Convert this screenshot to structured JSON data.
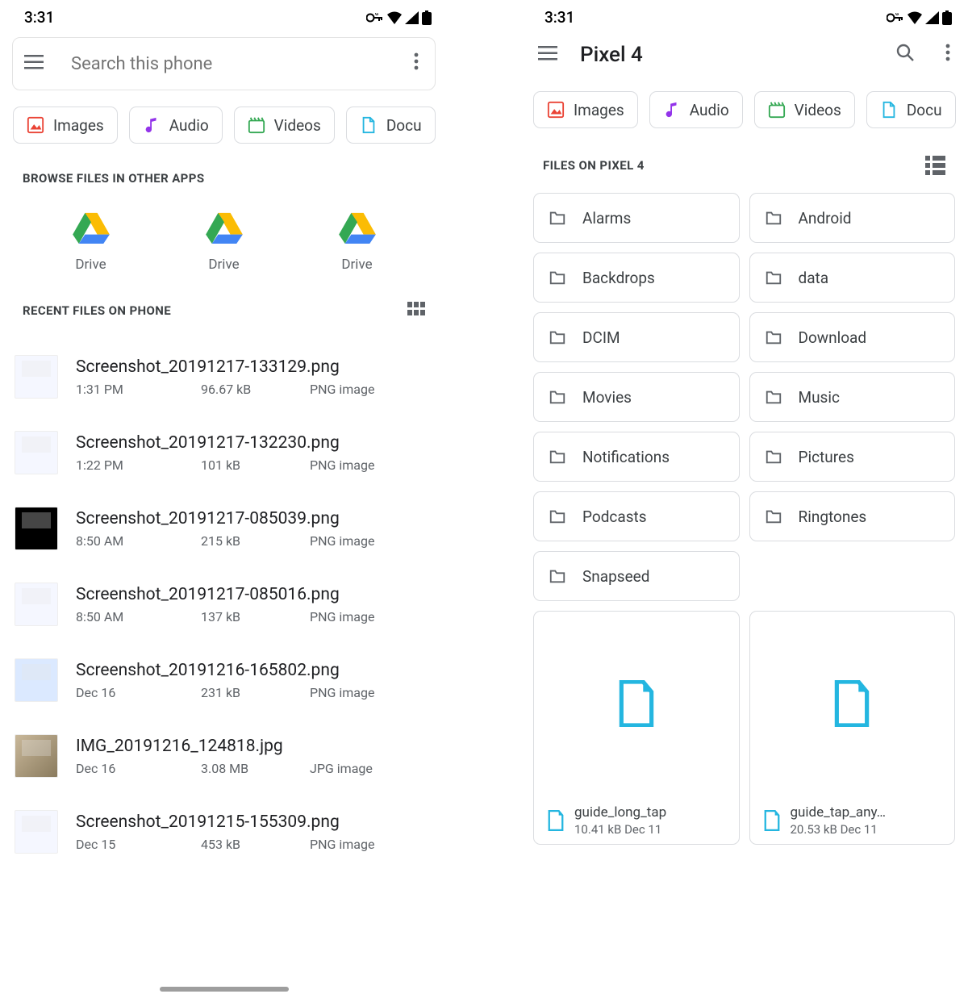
{
  "status": {
    "time": "3:31"
  },
  "left": {
    "search_placeholder": "Search this phone",
    "chips": [
      {
        "label": "Images"
      },
      {
        "label": "Audio"
      },
      {
        "label": "Videos"
      },
      {
        "label": "Docu"
      }
    ],
    "browse_header": "BROWSE FILES IN OTHER APPS",
    "drive_items": [
      {
        "label": "Drive"
      },
      {
        "label": "Drive"
      },
      {
        "label": "Drive"
      }
    ],
    "recent_header": "RECENT FILES ON PHONE",
    "files": [
      {
        "name": "Screenshot_20191217-133129.png",
        "time": "1:31 PM",
        "size": "96.67 kB",
        "type": "PNG image",
        "thumb": ""
      },
      {
        "name": "Screenshot_20191217-132230.png",
        "time": "1:22 PM",
        "size": "101 kB",
        "type": "PNG image",
        "thumb": ""
      },
      {
        "name": "Screenshot_20191217-085039.png",
        "time": "8:50 AM",
        "size": "215 kB",
        "type": "PNG image",
        "thumb": "phone"
      },
      {
        "name": "Screenshot_20191217-085016.png",
        "time": "8:50 AM",
        "size": "137 kB",
        "type": "PNG image",
        "thumb": ""
      },
      {
        "name": "Screenshot_20191216-165802.png",
        "time": "Dec 16",
        "size": "231 kB",
        "type": "PNG image",
        "thumb": "blue"
      },
      {
        "name": "IMG_20191216_124818.jpg",
        "time": "Dec 16",
        "size": "3.08 MB",
        "type": "JPG image",
        "thumb": "photo"
      },
      {
        "name": "Screenshot_20191215-155309.png",
        "time": "Dec 15",
        "size": "453 kB",
        "type": "PNG image",
        "thumb": ""
      }
    ]
  },
  "right": {
    "title": "Pixel 4",
    "chips": [
      {
        "label": "Images"
      },
      {
        "label": "Audio"
      },
      {
        "label": "Videos"
      },
      {
        "label": "Docu"
      }
    ],
    "files_header": "FILES ON PIXEL 4",
    "folders": [
      "Alarms",
      "Android",
      "Backdrops",
      "data",
      "DCIM",
      "Download",
      "Movies",
      "Music",
      "Notifications",
      "Pictures",
      "Podcasts",
      "Ringtones",
      "Snapseed"
    ],
    "cards": [
      {
        "name": "guide_long_tap",
        "meta": "10.41 kB Dec 11"
      },
      {
        "name": "guide_tap_any…",
        "meta": "20.53 kB Dec 11"
      }
    ]
  }
}
